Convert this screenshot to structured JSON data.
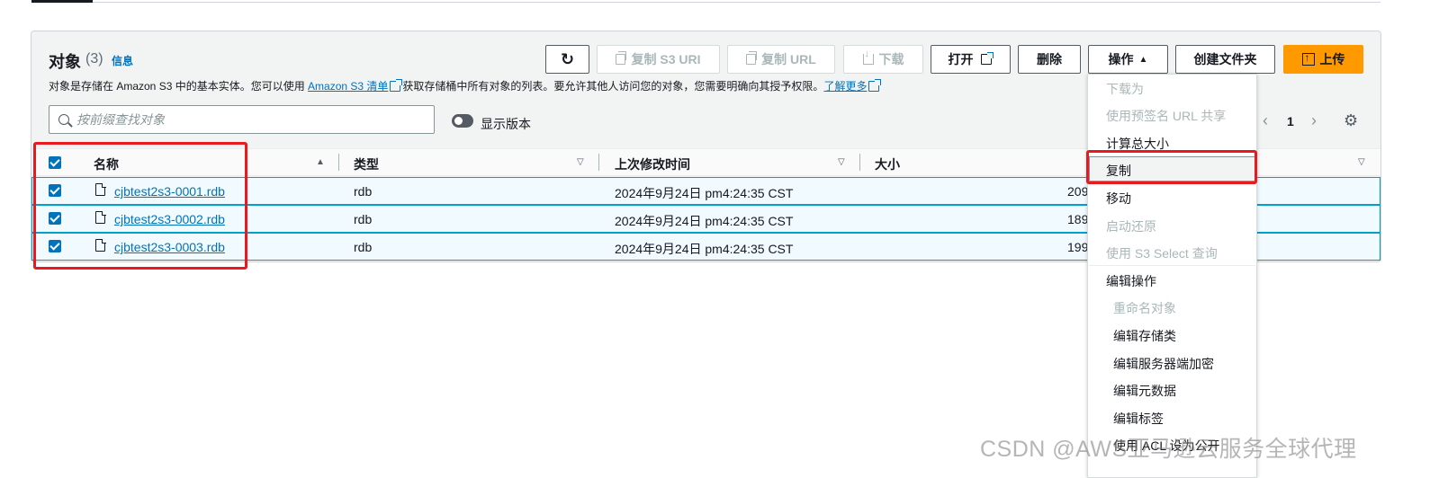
{
  "header": {
    "title": "对象",
    "count": "(3)",
    "info": "信息",
    "desc_before": "对象是存储在 Amazon S3 中的基本实体。您可以使用 ",
    "desc_link1": "Amazon S3 清单",
    "desc_middle": "获取存储桶中所有对象的列表。要允许其他人访问您的对象，您需要明确向其授予权限。",
    "desc_link2": "了解更多"
  },
  "toolbar": {
    "copy_s3_uri": "复制 S3 URI",
    "copy_url": "复制 URL",
    "download": "下载",
    "open": "打开",
    "delete": "删除",
    "actions": "操作",
    "create_folder": "创建文件夹",
    "upload": "上传"
  },
  "search": {
    "placeholder": "按前缀查找对象"
  },
  "versions_toggle_label": "显示版本",
  "pagination": {
    "page": "1"
  },
  "table": {
    "columns": {
      "name": "名称",
      "type": "类型",
      "last_modified": "上次修改时间",
      "size": "大小"
    },
    "rows": [
      {
        "name": "cjbtest2s3-0001.rdb",
        "type": "rdb",
        "modified": "2024年9月24日 pm4:24:35 CST",
        "size": "209"
      },
      {
        "name": "cjbtest2s3-0002.rdb",
        "type": "rdb",
        "modified": "2024年9月24日 pm4:24:35 CST",
        "size": "189"
      },
      {
        "name": "cjbtest2s3-0003.rdb",
        "type": "rdb",
        "modified": "2024年9月24日 pm4:24:35 CST",
        "size": "199"
      }
    ]
  },
  "actions_menu": {
    "download_as": "下载为",
    "presigned_url": "使用预签名 URL 共享",
    "calc_size": "计算总大小",
    "copy": "复制",
    "move": "移动",
    "restore": "启动还原",
    "s3_select": "使用 S3 Select 查询",
    "edit_actions": "编辑操作",
    "rename": "重命名对象",
    "edit_storage_class": "编辑存储类",
    "edit_encryption": "编辑服务器端加密",
    "edit_metadata": "编辑元数据",
    "edit_tags": "编辑标签",
    "make_public_acl": "使用 ACL 设为公开"
  },
  "watermark": "CSDN @AWS亚马逊云服务全球代理",
  "colors": {
    "primary_button": "#ff9900",
    "link": "#0073bb",
    "annotation_box": "#e8191f"
  }
}
